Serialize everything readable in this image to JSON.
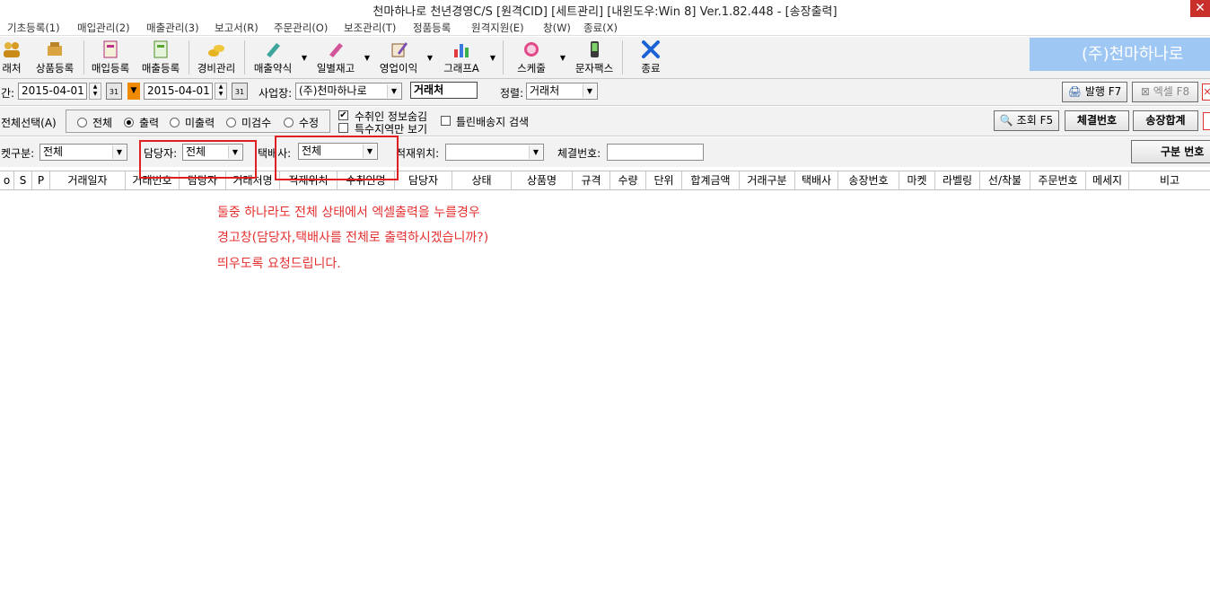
{
  "window": {
    "title": "천마하나로 천년경영C/S [원격CID] [세트관리] [내윈도우:Win 8] Ver.1.82.448 - [송장출력]"
  },
  "menu": [
    {
      "label": "기초등록(1)"
    },
    {
      "label": "매입관리(2)"
    },
    {
      "label": "매출관리(3)"
    },
    {
      "label": "보고서(R)"
    },
    {
      "label": "주문관리(O)"
    },
    {
      "label": "보조관리(T)"
    },
    {
      "label": "정품등록"
    },
    {
      "label": "원격지원(E)"
    },
    {
      "label": "창(W)"
    },
    {
      "label": "종료(X)"
    }
  ],
  "toolbar": {
    "items": [
      {
        "label": "래처",
        "icon": "people-icon"
      },
      {
        "label": "상품등록",
        "icon": "box-icon"
      },
      {
        "label": "매입등록",
        "icon": "purchase-icon"
      },
      {
        "label": "매출등록",
        "icon": "sales-icon"
      },
      {
        "label": "경비관리",
        "icon": "coins-icon"
      },
      {
        "label": "매출약식",
        "icon": "pen-icon"
      },
      {
        "label": "일별재고",
        "icon": "stock-icon"
      },
      {
        "label": "영업이익",
        "icon": "profit-icon"
      },
      {
        "label": "그래프A",
        "icon": "bar-chart-icon"
      },
      {
        "label": "스케줄",
        "icon": "clock-icon"
      },
      {
        "label": "문자팩스",
        "icon": "phone-icon"
      },
      {
        "label": "종료",
        "icon": "close-x-icon"
      }
    ],
    "company": "(주)천마하나로"
  },
  "filters": {
    "period_label": "간:",
    "date_from": "2015-04-01",
    "date_to": "2015-04-01",
    "calendar_text": "31",
    "site_label": "사업장:",
    "site_value": "(주)천마하나로",
    "account_value": "거래처",
    "sort_label": "정렬:",
    "sort_value": "거래처",
    "issue_button": "발행 F7",
    "excel_button": "엑셀 F8"
  },
  "selection": {
    "all_label": "전체선택(A)",
    "options": [
      {
        "label": "전체",
        "checked": false
      },
      {
        "label": "출력",
        "checked": true
      },
      {
        "label": "미출력",
        "checked": false
      },
      {
        "label": "미검수",
        "checked": false
      },
      {
        "label": "수정",
        "checked": false
      }
    ],
    "check_hide_receiver": "수취인 정보숨김",
    "check_special_area": "특수지역만 보기",
    "check_wrong_addr": "틀린배송지 검색",
    "search_button": "조회 F5",
    "settle_button": "체결번호",
    "invoice_sum_button": "송장합계"
  },
  "row3": {
    "market_label": "켓구분:",
    "market_value": "전체",
    "manager_label": "담당자:",
    "manager_value": "전체",
    "courier_label": "택배사:",
    "courier_value": "전체",
    "location_label": "적재위치:",
    "location_value": "",
    "settle_label": "체결번호:",
    "settle_value": "",
    "split_button": "구분 번호"
  },
  "grid": {
    "columns": [
      "o",
      "S",
      "P",
      "거래일자",
      "거래번호",
      "담당자",
      "거래처명",
      "적재위치",
      "수취인명",
      "담당자",
      "상태",
      "상품명",
      "규격",
      "수량",
      "단위",
      "합계금액",
      "거래구분",
      "택배사",
      "송장번호",
      "마켓",
      "라벨링",
      "선/착불",
      "주문번호",
      "메세지",
      "비고"
    ]
  },
  "annotation": {
    "line1": "둘중 하나라도 전체 상태에서 엑셀출력을 누를경우",
    "line2": "경고창(담당자,택배사를 전체로 출력하시겠습니까?)",
    "line3": "띄우도록 요청드립니다."
  },
  "colors": {
    "annotation": "#e53030",
    "banner": "#9fc7f4",
    "close": "#c9302c"
  }
}
